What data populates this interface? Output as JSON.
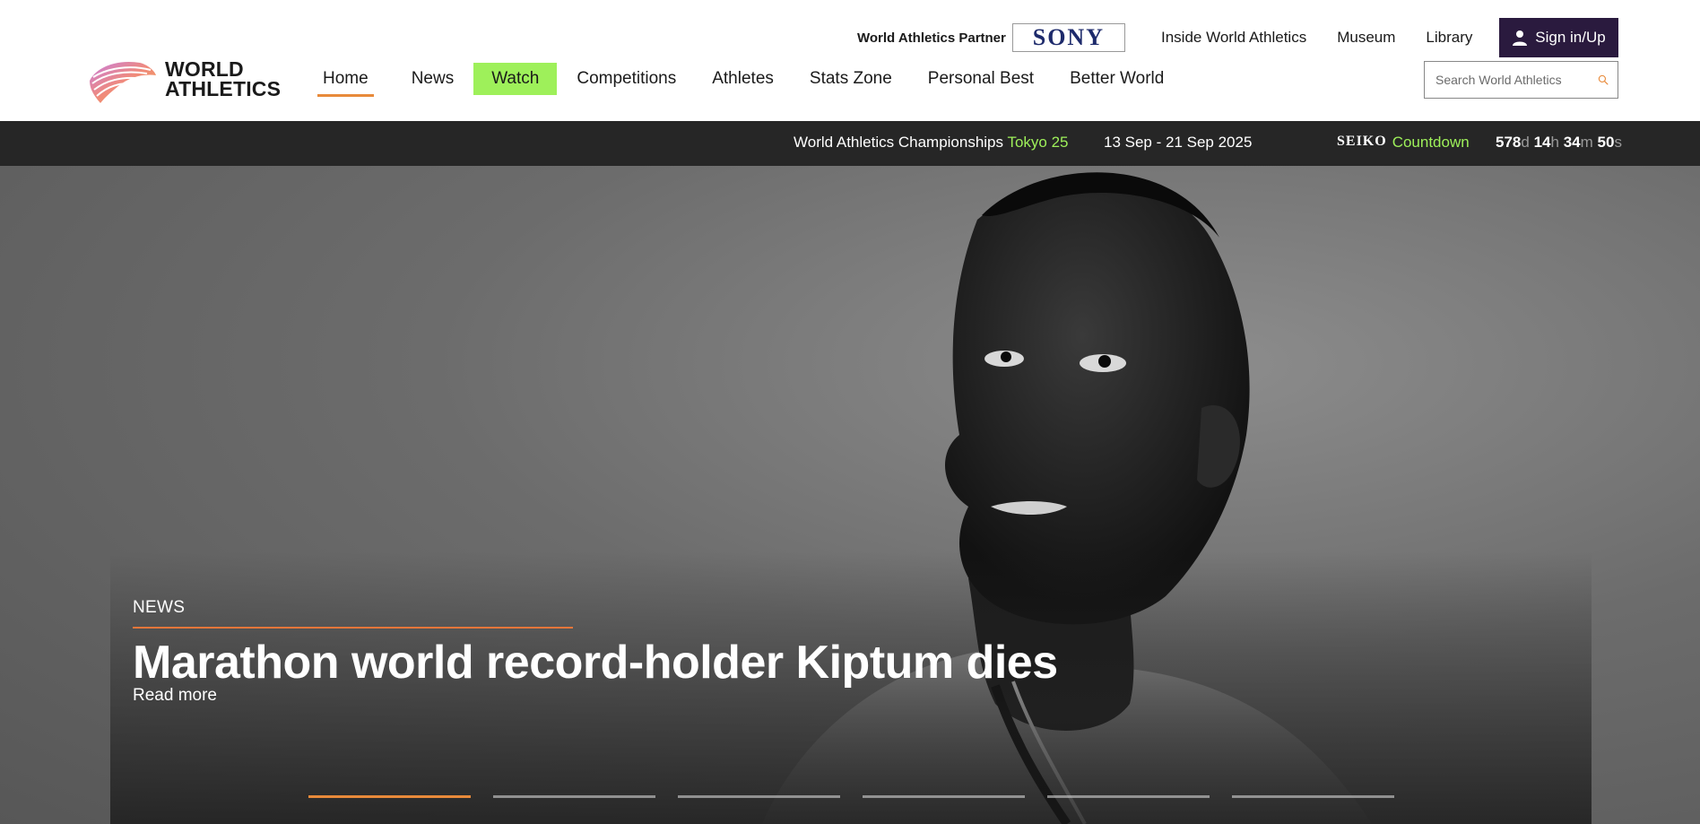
{
  "brand": {
    "logo_line1": "WORLD",
    "logo_line2": "ATHLETICS"
  },
  "partner": {
    "label": "World Athletics Partner",
    "sponsor": "SONY"
  },
  "top_links": [
    {
      "label": "Inside World Athletics"
    },
    {
      "label": "Museum"
    },
    {
      "label": "Library"
    }
  ],
  "signin": {
    "label": "Sign in/Up"
  },
  "search": {
    "placeholder": "Search World Athletics"
  },
  "nav": {
    "home": "Home",
    "news": "News",
    "watch": "Watch",
    "competitions": "Competitions",
    "athletes": "Athletes",
    "stats": "Stats Zone",
    "personal_best": "Personal Best",
    "better_world": "Better World"
  },
  "banner": {
    "event": "World Athletics Championships",
    "event_accent": "Tokyo 25",
    "dates": "13 Sep - 21 Sep 2025",
    "sponsor": "SEIKO",
    "countdown_label": "Countdown",
    "days": "578",
    "days_unit": "d",
    "hours": "14",
    "hours_unit": "h",
    "minutes": "34",
    "minutes_unit": "m",
    "seconds": "50",
    "seconds_unit": "s"
  },
  "hero": {
    "kicker": "NEWS",
    "headline": "Marathon world record-holder Kiptum dies",
    "read_more": "Read more",
    "slides_total": 6,
    "active_slide": 1
  },
  "colors": {
    "accent_orange": "#e88a3a",
    "accent_green": "#9ef05a",
    "signin_bg": "#2a1a3e",
    "banner_bg": "#262626"
  }
}
